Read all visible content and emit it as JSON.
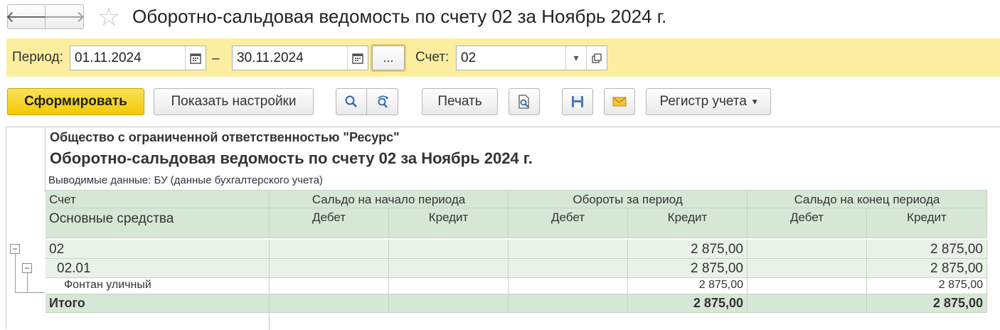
{
  "window": {
    "title": "Оборотно-сальдовая ведомость по счету 02 за Ноябрь 2024 г.",
    "back_glyph": "🡐",
    "forward_glyph": "🡒",
    "star_glyph": "☆"
  },
  "filter": {
    "period_label": "Период:",
    "date_from": "01.11.2024",
    "dash": "–",
    "date_to": "30.11.2024",
    "dots_label": "...",
    "account_label": "Счет:",
    "account_value": "02"
  },
  "toolbar": {
    "generate_label": "Сформировать",
    "show_settings_label": "Показать настройки",
    "print_label": "Печать",
    "register_label": "Регистр учета",
    "register_arrow": "▾"
  },
  "report": {
    "organization": "Общество с ограниченной ответственностью \"Ресурс\"",
    "title": "Оборотно-сальдовая ведомость по счету 02 за Ноябрь 2024 г.",
    "output_data": "Выводимые данные: БУ (данные бухгалтерского учета)",
    "header": {
      "col_account": "Счет",
      "col_subconto": "Основные средства",
      "group_start": "Сальдо на начало периода",
      "group_turnover": "Обороты за период",
      "group_end": "Сальдо на конец периода",
      "debit": "Дебет",
      "credit": "Кредит"
    },
    "rows": [
      {
        "account": "02",
        "start_debit": "",
        "start_credit": "",
        "turn_debit": "",
        "turn_credit": "2 875,00",
        "end_debit": "",
        "end_credit": "2 875,00"
      },
      {
        "account": "02.01",
        "start_debit": "",
        "start_credit": "",
        "turn_debit": "",
        "turn_credit": "2 875,00",
        "end_debit": "",
        "end_credit": "2 875,00"
      },
      {
        "account": "Фонтан уличный",
        "start_debit": "",
        "start_credit": "",
        "turn_debit": "",
        "turn_credit": "2 875,00",
        "end_debit": "",
        "end_credit": "2 875,00"
      }
    ],
    "total": {
      "label": "Итого",
      "turn_credit": "2 875,00",
      "end_credit": "2 875,00"
    },
    "toggle_glyph": "−"
  }
}
